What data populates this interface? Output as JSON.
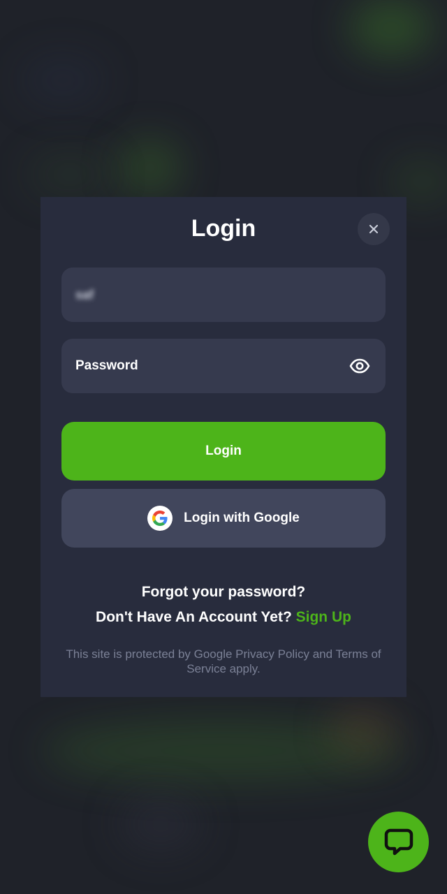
{
  "modal": {
    "title": "Login",
    "close_icon": "close-icon"
  },
  "form": {
    "username_value": "saf",
    "password_placeholder": "Password",
    "password_toggle_icon": "eye-icon"
  },
  "buttons": {
    "login_label": "Login",
    "google_label": "Login with Google",
    "google_icon": "google-icon"
  },
  "links": {
    "forgot_password": "Forgot your password?",
    "no_account_text": "Don't Have An Account Yet?",
    "sign_up": "Sign Up"
  },
  "legal": {
    "notice": "This site is protected by Google Privacy Policy and Terms of Service apply."
  },
  "chat": {
    "icon": "chat-bubble-icon"
  },
  "colors": {
    "accent": "#4db41a",
    "modal_bg": "#282c3d",
    "field_bg": "#363a4e",
    "google_button_bg": "#41465c"
  }
}
